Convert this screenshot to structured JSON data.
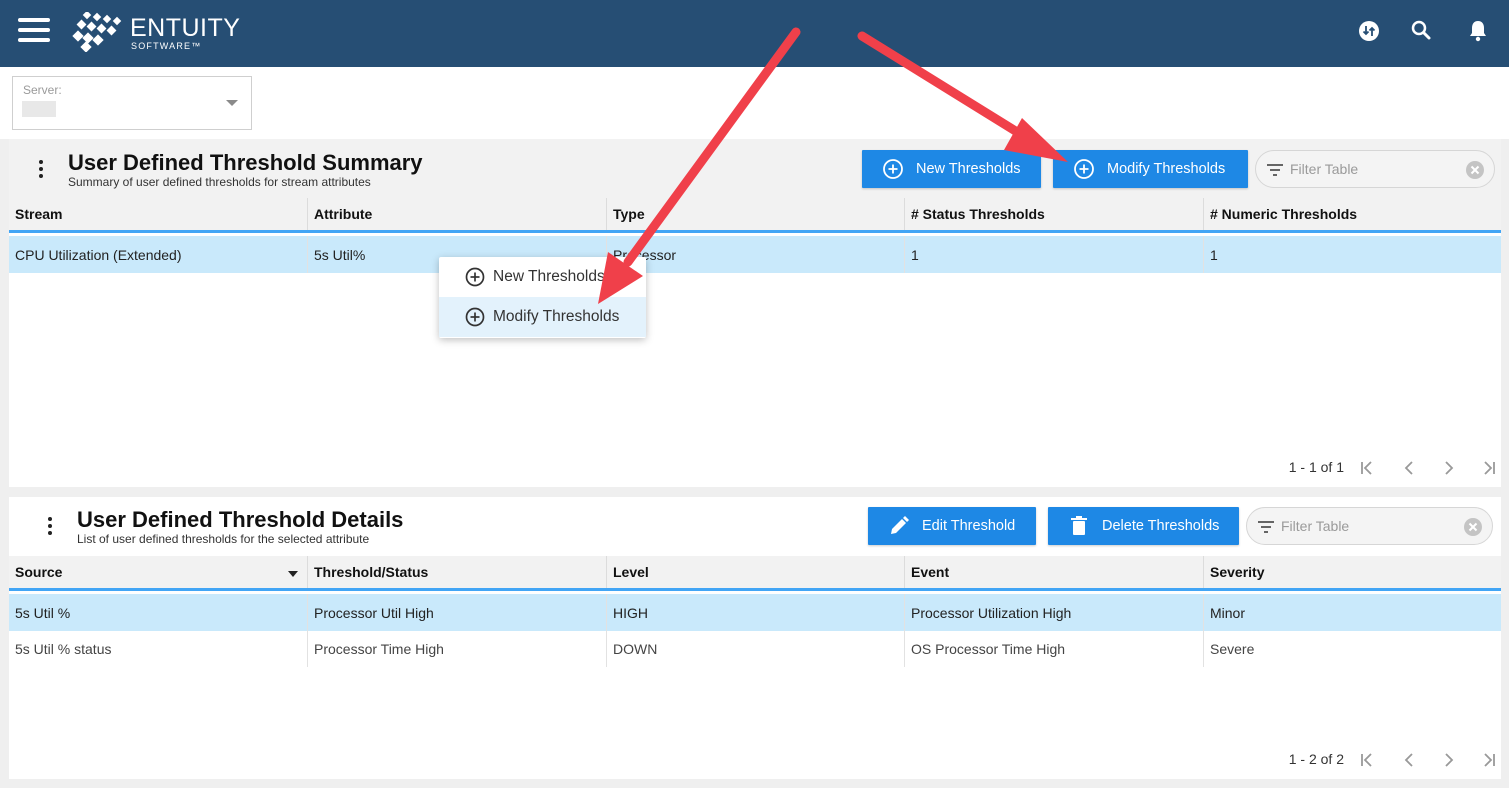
{
  "app": {
    "logo_name": "ENTUITY",
    "logo_sub": "SOFTWARE™"
  },
  "server": {
    "label": "Server:",
    "value": ""
  },
  "summary": {
    "title": "User Defined Threshold Summary",
    "subtitle": "Summary of user defined thresholds for stream attributes",
    "new_button": "New Thresholds",
    "modify_button": "Modify Thresholds",
    "filter_placeholder": "Filter Table",
    "columns": [
      "Stream",
      "Attribute",
      "Type",
      "# Status Thresholds",
      "# Numeric Thresholds"
    ],
    "rows": [
      {
        "stream": "CPU Utilization (Extended)",
        "attribute": "5s Util%",
        "type": "Processor",
        "status": "1",
        "numeric": "1"
      }
    ],
    "pager": "1 - 1 of 1"
  },
  "context_menu": {
    "items": [
      "New Thresholds",
      "Modify Thresholds"
    ]
  },
  "details": {
    "title": "User Defined Threshold Details",
    "subtitle": "List of user defined thresholds for the selected attribute",
    "edit_button": "Edit Threshold",
    "delete_button": "Delete Thresholds",
    "filter_placeholder": "Filter Table",
    "columns": [
      "Source",
      "Threshold/Status",
      "Level",
      "Event",
      "Severity"
    ],
    "rows": [
      {
        "source": "5s Util %",
        "threshold": "Processor Util High",
        "level": "HIGH",
        "event": "Processor Utilization High",
        "severity": "Minor"
      },
      {
        "source": "5s Util % status",
        "threshold": "Processor Time High",
        "level": "DOWN",
        "event": "OS Processor Time High",
        "severity": "Severe"
      }
    ],
    "pager": "1 - 2 of 2"
  },
  "icons": {
    "menu": "hamburger-icon",
    "sync": "sync-icon",
    "search": "search-icon",
    "bell": "bell-icon",
    "add": "add-circle-icon",
    "edit": "pencil-icon",
    "delete": "trash-icon",
    "filter": "filter-icon",
    "clear": "clear-icon"
  },
  "colors": {
    "topbar": "#264e74",
    "button": "#1e88e5",
    "selected_row": "#c9e9fb",
    "header_accent": "#42a5f5",
    "annotation_arrow": "#f0404a"
  }
}
